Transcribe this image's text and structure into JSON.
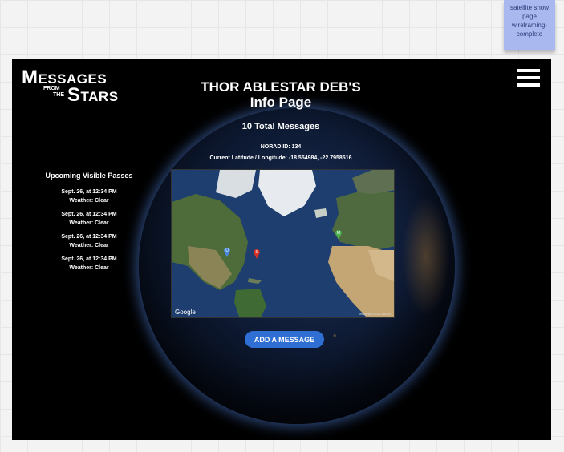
{
  "sticky_note": {
    "text": "satellite show page wireframing-complete"
  },
  "header": {
    "logo_line1_cap": "M",
    "logo_line1_rest": "ESSAGES",
    "logo_line2_top": "FROM",
    "logo_line2_bottom": "THE",
    "logo_line3_cap": "S",
    "logo_line3_rest": "TARS"
  },
  "page": {
    "title_line1": "THOR ABLESTAR DEB'S",
    "title_line2": "Info Page",
    "total_messages": "10 Total Messages",
    "norad": "NORAD ID: 134",
    "coords_label": "Current Latitude / Longitude:  -18.554984, -22.7958516"
  },
  "passes": {
    "heading": "Upcoming Visible Passes",
    "items": [
      {
        "date": "Sept. 26, at 12:34 PM",
        "weather": "Weather: Clear"
      },
      {
        "date": "Sept. 26, at 12:34 PM",
        "weather": "Weather: Clear"
      },
      {
        "date": "Sept. 26, at 12:34 PM",
        "weather": "Weather: Clear"
      },
      {
        "date": "Sept. 26, at 12:34 PM",
        "weather": "Weather: Clear"
      }
    ]
  },
  "map": {
    "google_label": "Google",
    "imagery_label": "Imagery ©2022 NASA",
    "pins": [
      {
        "letter": "U",
        "color": "#4a88dd"
      },
      {
        "letter": "S",
        "color": "#d93025"
      },
      {
        "letter": "M",
        "color": "#4caf50"
      }
    ]
  },
  "actions": {
    "add_message": "ADD A MESSAGE"
  },
  "colors": {
    "accent": "#2f6fd3",
    "sticky": "#a9b8ef"
  }
}
